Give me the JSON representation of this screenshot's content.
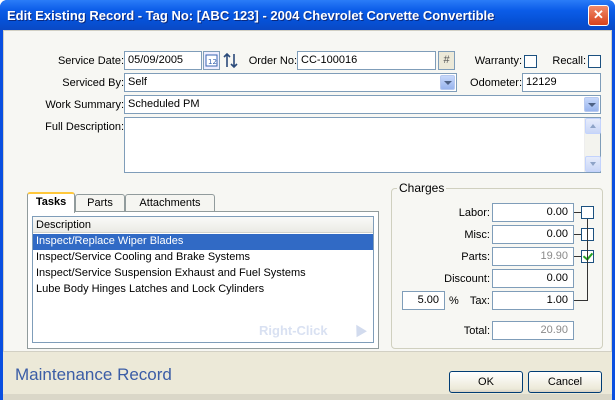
{
  "window": {
    "title": "Edit Existing Record - Tag No: [ABC 123] - 2004 Chevrolet Corvette Convertible",
    "close_glyph": "✕"
  },
  "form": {
    "service_date": {
      "label": "Service Date:",
      "value": "05/09/2005"
    },
    "order_no": {
      "label": "Order No:",
      "value": "CC-100016",
      "button": "#"
    },
    "warranty": {
      "label": "Warranty:",
      "checked": false
    },
    "recall": {
      "label": "Recall:",
      "checked": false
    },
    "serviced_by": {
      "label": "Serviced By:",
      "value": "Self"
    },
    "odometer": {
      "label": "Odometer:",
      "value": "12129"
    },
    "work_summary": {
      "label": "Work Summary:",
      "value": "Scheduled PM"
    },
    "full_description": {
      "label": "Full Description:",
      "value": ""
    }
  },
  "tabs": [
    {
      "label": "Tasks",
      "active": true
    },
    {
      "label": "Parts",
      "active": false
    },
    {
      "label": "Attachments",
      "active": false
    }
  ],
  "tasks": {
    "column": "Description",
    "rows": [
      {
        "text": "Inspect/Replace Wiper Blades",
        "selected": true
      },
      {
        "text": "Inspect/Service Cooling and Brake Systems",
        "selected": false
      },
      {
        "text": "Inspect/Service Suspension Exhaust and Fuel Systems",
        "selected": false
      },
      {
        "text": "Lube Body Hinges Latches and Lock Cylinders",
        "selected": false
      }
    ],
    "watermark": "Right-Click"
  },
  "charges": {
    "title": "Charges",
    "labor": {
      "label": "Labor:",
      "value": "0.00",
      "taxable": false
    },
    "misc": {
      "label": "Misc:",
      "value": "0.00",
      "taxable": false
    },
    "parts": {
      "label": "Parts:",
      "value": "19.90",
      "taxable": true
    },
    "discount": {
      "label": "Discount:",
      "value": "0.00"
    },
    "tax_rate": {
      "value": "5.00",
      "unit": "%"
    },
    "tax": {
      "label": "Tax:",
      "value": "1.00"
    },
    "total": {
      "label": "Total:",
      "value": "20.90"
    }
  },
  "footer": {
    "title": "Maintenance Record",
    "ok": "OK",
    "cancel": "Cancel"
  }
}
